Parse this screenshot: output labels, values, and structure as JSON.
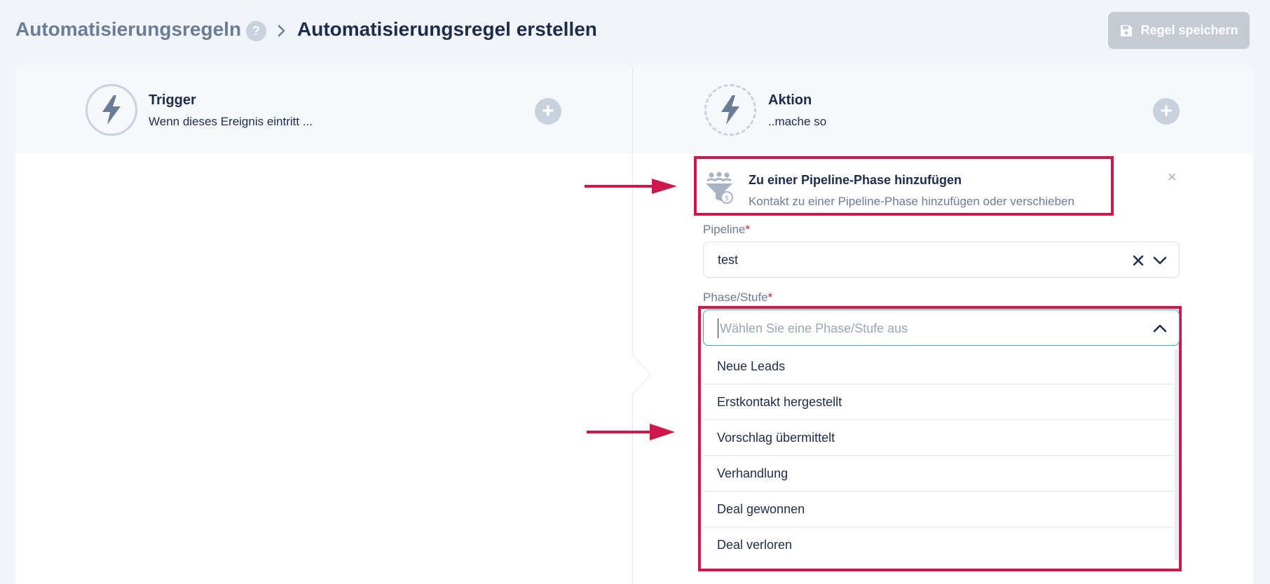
{
  "header": {
    "breadcrumb_parent": "Automatisierungsregeln",
    "help_glyph": "?",
    "breadcrumb_current": "Automatisierungsregel erstellen",
    "save_label": "Regel speichern"
  },
  "trigger": {
    "title": "Trigger",
    "subtitle": "Wenn dieses Ereignis eintritt ...",
    "icon": "lightning-icon"
  },
  "action": {
    "title": "Aktion",
    "subtitle": "..mache so",
    "icon": "lightning-cycle-icon"
  },
  "selected_action": {
    "title": "Zu einer Pipeline-Phase hinzufügen",
    "description": "Kontakt zu einer Pipeline-Phase hinzufügen oder verschieben",
    "icon": "pipeline-funnel-icon",
    "close_glyph": "×"
  },
  "pipeline_field": {
    "label": "Pipeline",
    "required_mark": "*",
    "value": "test"
  },
  "phase_field": {
    "label": "Phase/Stufe",
    "required_mark": "*",
    "placeholder": "Wählen Sie eine Phase/Stufe aus",
    "options": [
      "Neue Leads",
      "Erstkontakt hergestellt",
      "Vorschlag übermittelt",
      "Verhandlung",
      "Deal gewonnen",
      "Deal verloren"
    ]
  },
  "colors": {
    "highlight": "#d0174a",
    "focus": "#3aa3e0",
    "muted": "#c8d2de",
    "text_dark": "#1e2c4c",
    "text_muted": "#6b7c96"
  }
}
